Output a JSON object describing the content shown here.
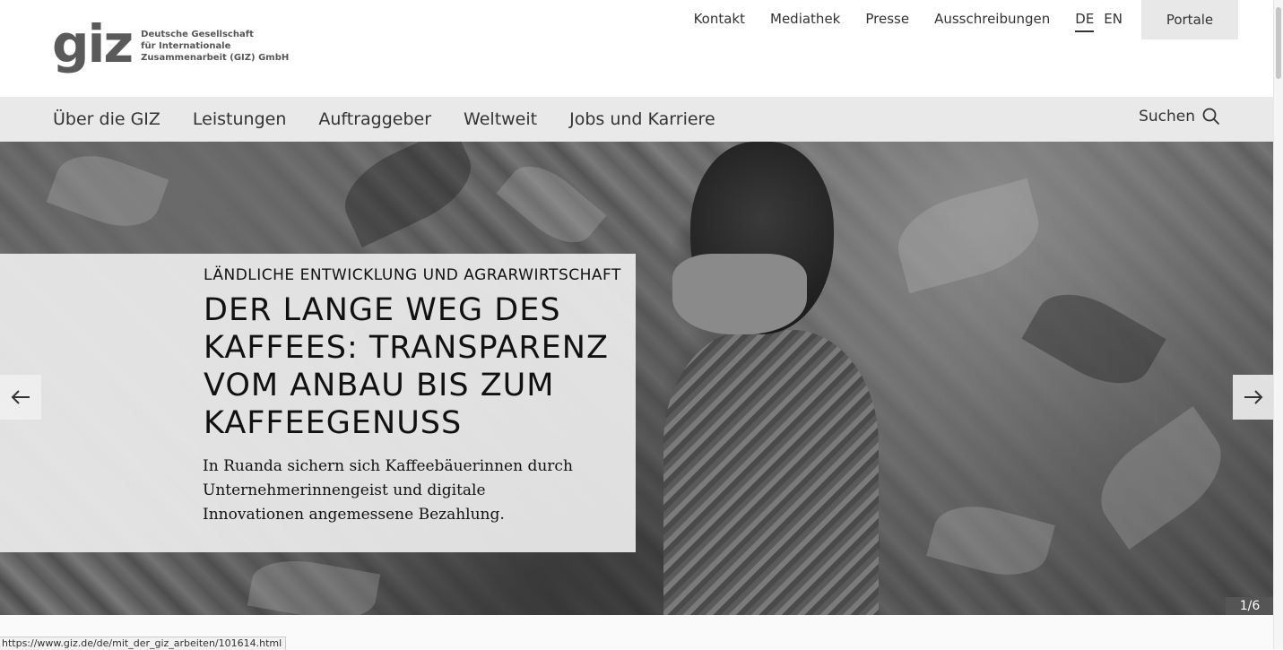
{
  "logo": {
    "mark": "giz",
    "lines": [
      "Deutsche Gesellschaft",
      "für Internationale",
      "Zusammenarbeit (GIZ) GmbH"
    ]
  },
  "meta_nav": {
    "links": [
      "Kontakt",
      "Mediathek",
      "Presse",
      "Ausschreibungen"
    ],
    "lang_active": "DE",
    "lang_other": "EN",
    "portale": "Portale"
  },
  "main_nav": {
    "items": [
      "Über die GIZ",
      "Leistungen",
      "Auftraggeber",
      "Weltweit",
      "Jobs und Karriere"
    ],
    "search_label": "Suchen"
  },
  "hero": {
    "kicker": "LÄNDLICHE ENTWICKLUNG UND AGRARWIRTSCHAFT",
    "headline": "DER LANGE WEG DES KAFFEES: TRANSPARENZ VOM ANBAU BIS ZUM KAFFEEGENUSS",
    "teaser": "In Ruanda sichern sich Kaffeebäuerinnen durch Unternehmerinnengeist und digitale Innovationen angemessene Bezahlung.",
    "counter": "1/6"
  },
  "status_url": "https://www.giz.de/de/mit_der_giz_arbeiten/101614.html"
}
